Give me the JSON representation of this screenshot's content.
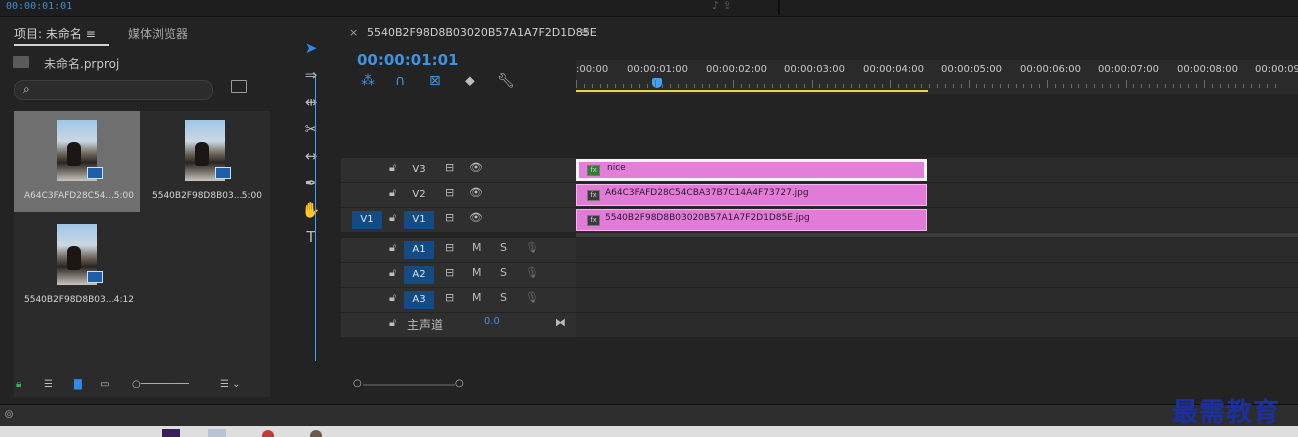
{
  "topbar": {
    "timecode": "00:00:01:01"
  },
  "project_panel": {
    "tab_project": "项目: 未命名",
    "tab_menu": "≡",
    "tab_media": "媒体浏览器",
    "project_file": "未命名.prproj",
    "items": [
      {
        "name": "A64C3FAFD28C54...",
        "duration": "5:00",
        "selected": true
      },
      {
        "name": "5540B2F98D8B03...",
        "duration": "5:00",
        "selected": false
      },
      {
        "name": "5540B2F98D8B03...",
        "duration": "4:12",
        "selected": false
      }
    ]
  },
  "timeline": {
    "close": "×",
    "sequence_name": "5540B2F98D8B03020B57A1A7F2D1D85E",
    "menu": "≡",
    "timecode": "00:00:01:01",
    "ruler_labels": [
      ":00:00",
      "00:00:01:00",
      "00:00:02:00",
      "00:00:03:00",
      "00:00:04:00",
      "00:00:05:00",
      "00:00:06:00",
      "00:00:07:00",
      "00:00:08:00",
      "00:00:09"
    ],
    "video_tracks": [
      {
        "label": "V3",
        "source": "",
        "clip": "nice"
      },
      {
        "label": "V2",
        "source": "",
        "clip": "A64C3FAFD28C54CBA37B7C14A4F73727.jpg"
      },
      {
        "label": "V1",
        "source": "V1",
        "clip": "5540B2F98D8B03020B57A1A7F2D1D85E.jpg"
      }
    ],
    "audio_tracks": [
      {
        "label": "A1",
        "mute": "M",
        "solo": "S"
      },
      {
        "label": "A2",
        "mute": "M",
        "solo": "S"
      },
      {
        "label": "A3",
        "mute": "M",
        "solo": "S"
      }
    ],
    "master": {
      "label": "主声道",
      "value": "0.0"
    }
  },
  "watermark": "最需教育",
  "colors": {
    "accent": "#2d8ceb",
    "clip": "#e27bd8",
    "workarea": "#e6d64a",
    "track_on": "#154b85"
  }
}
